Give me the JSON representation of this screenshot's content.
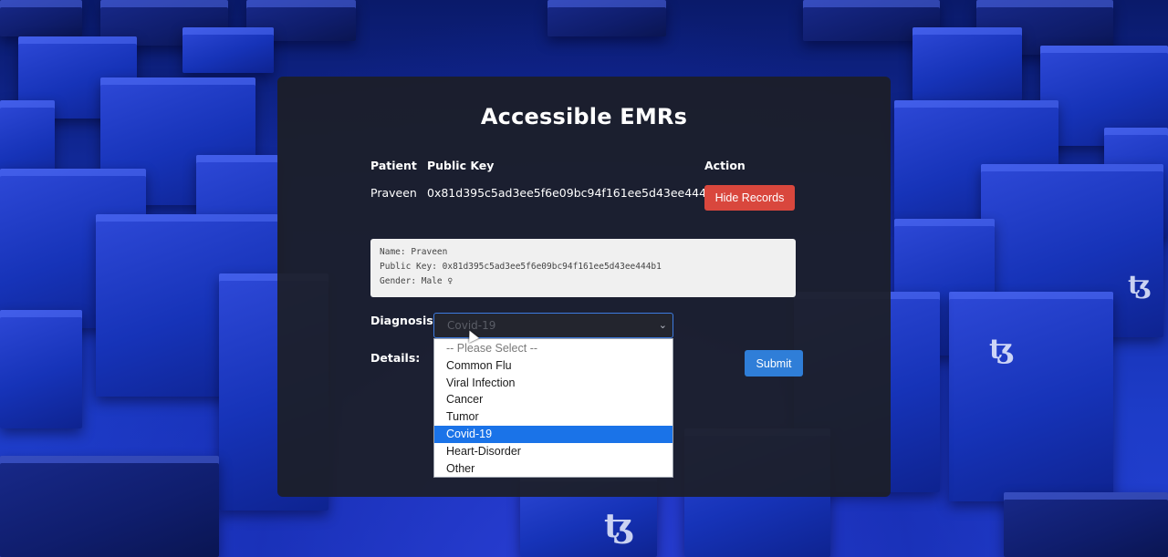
{
  "panel": {
    "title": "Accessible EMRs"
  },
  "table": {
    "headers": {
      "patient": "Patient",
      "public_key": "Public Key",
      "action": "Action"
    },
    "row": {
      "patient": "Praveen",
      "public_key": "0x81d395c5ad3ee5f6e09bc94f161ee5d43ee444b1",
      "action_label": "Hide Records"
    }
  },
  "record": {
    "name_line": "Name: Praveen",
    "key_line": "Public Key: 0x81d395c5ad3ee5f6e09bc94f161ee5d43ee444b1",
    "gender_line": "Gender: Male ♀"
  },
  "form": {
    "diagnosis_label": "Diagnosis:",
    "details_label": "Details:",
    "selected_value": "Covid-19",
    "options": [
      "-- Please Select --",
      "Common Flu",
      "Viral Infection",
      "Cancer",
      "Tumor",
      "Covid-19",
      "Heart-Disorder",
      "Other"
    ],
    "selected_index": 5,
    "submit_label": "Submit"
  },
  "background": {
    "logo_glyph": "ꜩ"
  },
  "colors": {
    "hide_button": "#d9473d",
    "submit_button": "#2f7ed8",
    "selected_option": "#1a73e8",
    "panel": "#1c1e26"
  }
}
